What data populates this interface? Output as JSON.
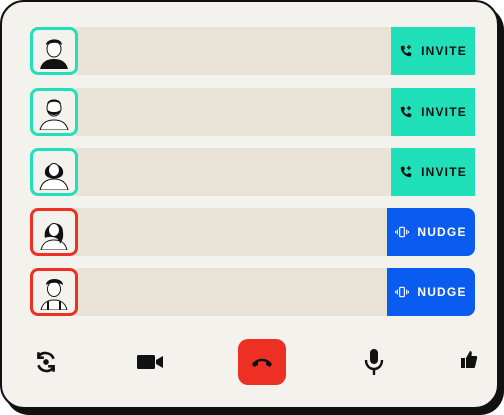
{
  "participants": [
    {
      "action_label": "INVITE",
      "action_type": "invite",
      "avatar": "man-dark-hair-icon",
      "status_color": "#1fe0b8"
    },
    {
      "action_label": "INVITE",
      "action_type": "invite",
      "avatar": "man-beard-icon",
      "status_color": "#1fe0b8"
    },
    {
      "action_label": "INVITE",
      "action_type": "invite",
      "avatar": "woman-hijab-icon",
      "status_color": "#1fe0b8"
    },
    {
      "action_label": "NUDGE",
      "action_type": "nudge",
      "avatar": "woman-long-hair-icon",
      "status_color": "#ee2f23"
    },
    {
      "action_label": "NUDGE",
      "action_type": "nudge",
      "avatar": "man-suspenders-icon",
      "status_color": "#ee2f23"
    }
  ],
  "controls": {
    "items": [
      "flip-camera-icon",
      "video-camera-icon",
      "end-call-icon",
      "microphone-icon",
      "thumbs-up-icon"
    ]
  },
  "colors": {
    "invite": "#1fe0b8",
    "nudge": "#0a5cf0",
    "end_call": "#ee2f23",
    "row_background": "#e9e2d6"
  }
}
